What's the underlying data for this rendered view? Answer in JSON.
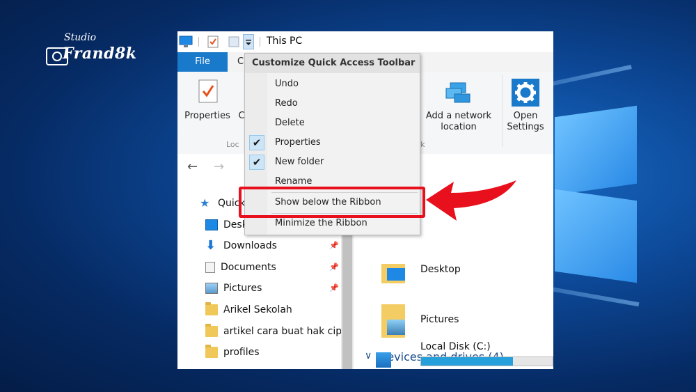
{
  "window": {
    "title": "This PC",
    "tabs": {
      "file": "File",
      "computer_partial": "C"
    }
  },
  "ribbon": {
    "properties": "Properties",
    "partial_c": "C",
    "partial_k": "k",
    "add_network_1": "Add a network",
    "add_network_2": "location",
    "open_settings_1": "Open",
    "open_settings_2": "Settings",
    "group_loc": "Loc",
    "group_network": "ork"
  },
  "qa_menu": {
    "heading": "Customize Quick Access Toolbar",
    "items": [
      {
        "label": "Undo",
        "checked": false
      },
      {
        "label": "Redo",
        "checked": false
      },
      {
        "label": "Delete",
        "checked": false
      },
      {
        "label": "Properties",
        "checked": true
      },
      {
        "label": "New folder",
        "checked": true
      },
      {
        "label": "Rename",
        "checked": false
      },
      {
        "label": "Show below the Ribbon",
        "checked": false
      },
      {
        "label": "Minimize the Ribbon",
        "checked": false
      }
    ],
    "check_glyph": "✔"
  },
  "nav_pane": {
    "items": [
      {
        "label": "Quick",
        "icon": "star-icon"
      },
      {
        "label": "Desk",
        "icon": "desktop-icon"
      },
      {
        "label": "Downloads",
        "icon": "download-icon",
        "pinned": true
      },
      {
        "label": "Documents",
        "icon": "document-icon",
        "pinned": true
      },
      {
        "label": "Pictures",
        "icon": "pictures-icon",
        "pinned": true
      },
      {
        "label": "Arikel Sekolah",
        "icon": "folder-icon"
      },
      {
        "label": "artikel cara buat hak cipta",
        "icon": "folder-icon"
      },
      {
        "label": "profiles",
        "icon": "folder-icon"
      }
    ],
    "pin_glyph": "📌"
  },
  "content": {
    "folders": [
      {
        "label": "Desktop"
      },
      {
        "label": "Pictures"
      }
    ],
    "devices_header": "Devices and drives (4)",
    "disk": {
      "label": "Local Disk (C:)",
      "used_fraction": 0.7
    }
  },
  "watermark": {
    "line1": "Studio",
    "line2": "Frand8k"
  },
  "colors": {
    "accent": "#1979ca",
    "highlight": "#e8101c"
  }
}
